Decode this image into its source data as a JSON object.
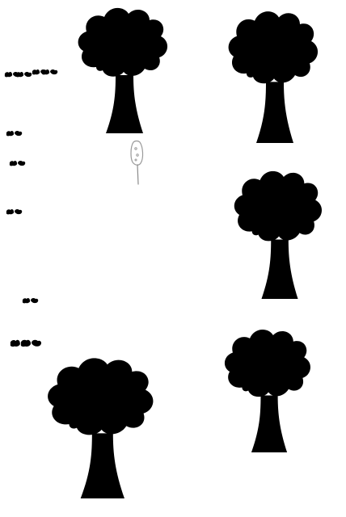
{
  "scene": {
    "background": "#ffffff",
    "stroke_color": "#000000",
    "objects": [
      {
        "name": "tree-1",
        "kind": "tree-icon"
      },
      {
        "name": "tree-2",
        "kind": "tree-icon"
      },
      {
        "name": "tree-3",
        "kind": "tree-icon"
      },
      {
        "name": "tree-4",
        "kind": "tree-icon"
      },
      {
        "name": "tree-5",
        "kind": "tree-icon"
      },
      {
        "name": "player-sprite",
        "kind": "lollipop-figure-icon"
      },
      {
        "name": "bush-group",
        "kind": "small-bush-icon"
      }
    ]
  }
}
